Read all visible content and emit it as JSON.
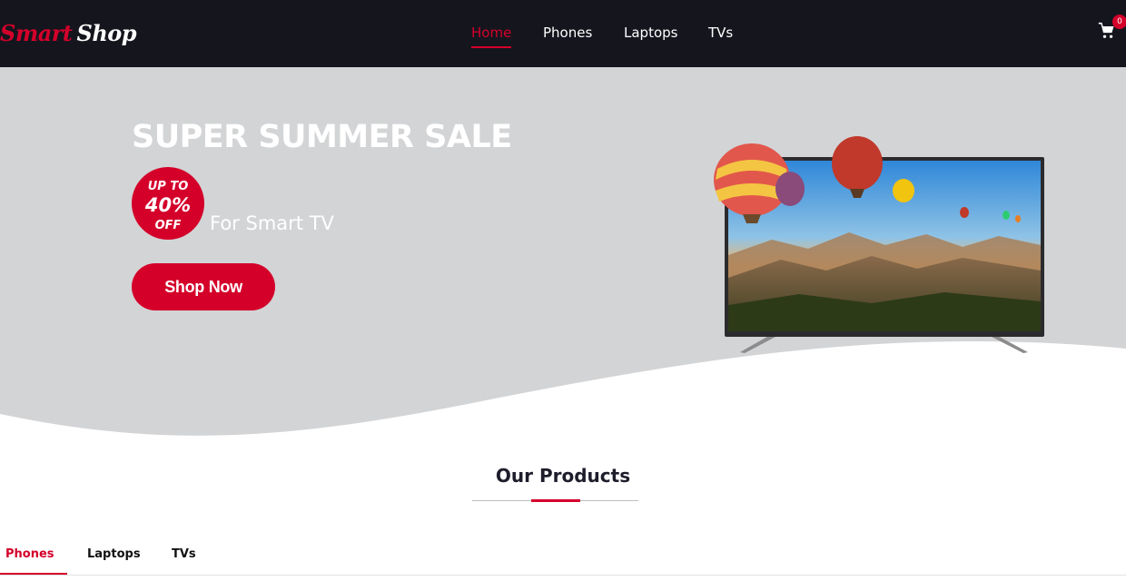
{
  "brand": {
    "word1": "Smart",
    "word2": "Shop"
  },
  "nav": {
    "items": [
      {
        "label": "Home",
        "active": true
      },
      {
        "label": "Phones",
        "active": false
      },
      {
        "label": "Laptops",
        "active": false
      },
      {
        "label": "TVs",
        "active": false
      }
    ],
    "cart_count": "0"
  },
  "hero": {
    "title": "SUPER SUMMER SALE",
    "badge_line1": "UP TO",
    "badge_line2": "40%",
    "badge_line3": "OFF",
    "subtitle": "For Smart TV",
    "cta": "Shop Now"
  },
  "products": {
    "title": "Our Products",
    "tabs": [
      {
        "label": "Phones",
        "active": true
      },
      {
        "label": "Laptops",
        "active": false
      },
      {
        "label": "TVs",
        "active": false
      }
    ]
  },
  "colors": {
    "accent": "#d4002a",
    "nav_bg": "#15151e",
    "hero_bg": "#d3d4d6"
  }
}
